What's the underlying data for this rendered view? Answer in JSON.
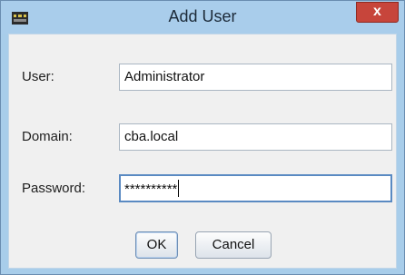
{
  "window": {
    "title": "Add User",
    "icon": "app-icon",
    "close_label": "x",
    "close_color": "#c7453b"
  },
  "form": {
    "user_label": "User:",
    "user_value": "Administrator",
    "domain_label": "Domain:",
    "domain_value": "cba.local",
    "password_label": "Password:",
    "password_value": "**********"
  },
  "buttons": {
    "ok_label": "OK",
    "cancel_label": "Cancel"
  }
}
